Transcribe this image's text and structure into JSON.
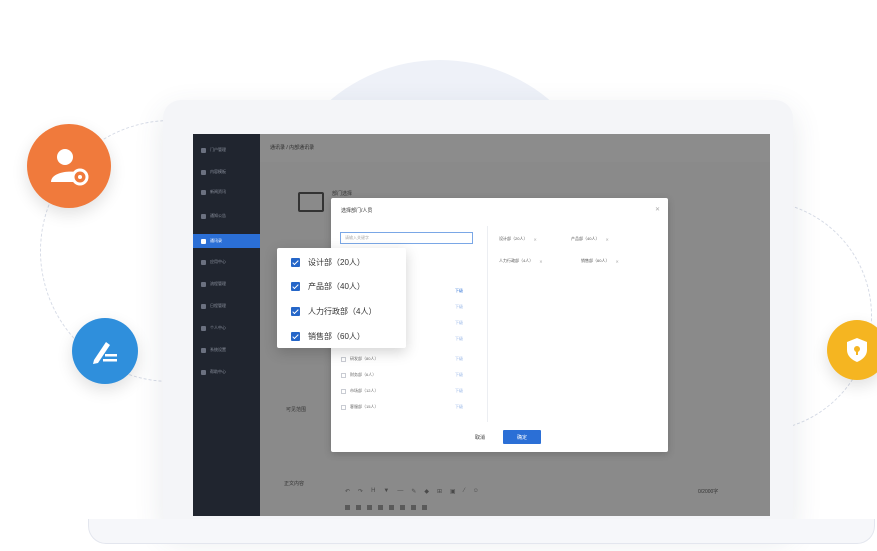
{
  "sidebar": {
    "items": [
      {
        "label": "门户管理"
      },
      {
        "label": "内容模板"
      },
      {
        "label": "新闻资讯"
      },
      {
        "label": "通知公告"
      },
      {
        "label": "通讯录"
      },
      {
        "label": "应用中心"
      },
      {
        "label": "流程管理"
      },
      {
        "label": "日程管理"
      },
      {
        "label": "个人中心"
      },
      {
        "label": "系统设置"
      },
      {
        "label": "帮助中心"
      }
    ]
  },
  "topbar": {
    "breadcrumb": "通讯录 / 内部通讯录"
  },
  "page": {
    "section_label": "部门选择",
    "field_label": "可见范围",
    "editor_label": "正文内容",
    "word_count": "0/2000字"
  },
  "modal": {
    "title": "选择部门/人员",
    "search_placeholder": "请输入关键字",
    "selected_tags": [
      {
        "label": "设计部（20人）"
      },
      {
        "label": "产品部（40人）"
      },
      {
        "label": "人力行政部（4人）"
      },
      {
        "label": "销售部（60人）"
      }
    ],
    "dept_rows": [
      {
        "label": "研发部（80人）"
      },
      {
        "label": "财务部（6人）"
      },
      {
        "label": "市场部（12人）"
      },
      {
        "label": "客服部（15人）"
      }
    ],
    "sub_link_label": "下级",
    "cancel_label": "取消",
    "ok_label": "确定"
  },
  "popup": {
    "items": [
      {
        "label": "设计部（20人）"
      },
      {
        "label": "产品部（40人）"
      },
      {
        "label": "人力行政部（4人）"
      },
      {
        "label": "销售部（60人）"
      }
    ]
  },
  "colors": {
    "accent": "#2b6fd6",
    "orange": "#f07a3c",
    "blue": "#2f8fdc",
    "yellow": "#f5b521",
    "sidebar": "#20252f"
  },
  "icons": {
    "left_top": "user-settings-icon",
    "left_bottom": "edit-document-icon",
    "right": "shield-icon"
  }
}
